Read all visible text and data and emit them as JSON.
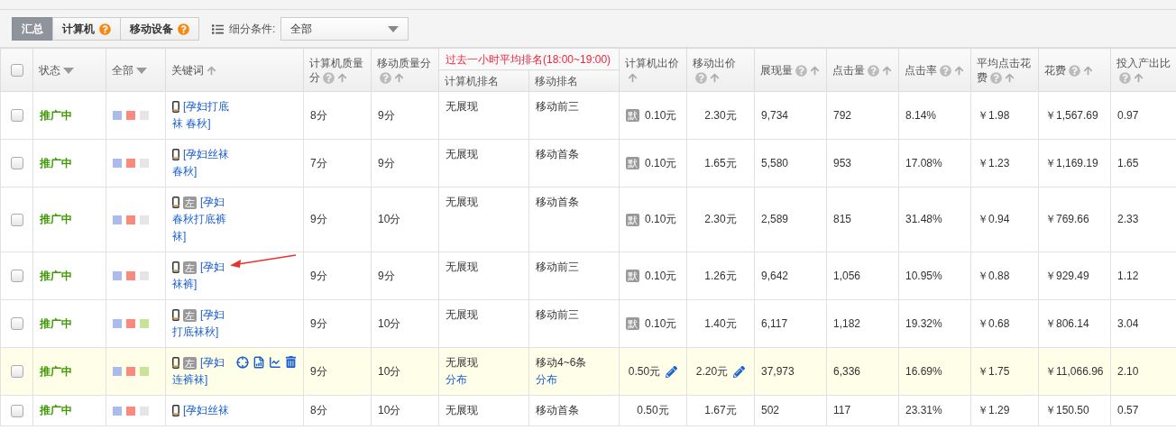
{
  "toolbar": {
    "tabs": [
      {
        "label": "汇总",
        "selected": true,
        "help": false
      },
      {
        "label": "计算机",
        "selected": false,
        "help": true
      },
      {
        "label": "移动设备",
        "selected": false,
        "help": true
      }
    ],
    "filter_label": "细分条件:",
    "filter_value": "全部"
  },
  "header": {
    "checked": false,
    "columns": [
      {
        "kind": "column",
        "label_lines": [
          "状态"
        ],
        "dropdown": true
      },
      {
        "kind": "column",
        "label_lines": [
          "全部"
        ],
        "dropdown": true
      },
      {
        "kind": "column",
        "label_lines": [
          "关键词"
        ],
        "sort": true
      },
      {
        "kind": "column",
        "label_lines": [
          "计算机质量",
          "分"
        ],
        "help": true,
        "sort": true
      },
      {
        "kind": "column",
        "label_lines": [
          "移动质量分"
        ],
        "help": true,
        "sort": true
      },
      {
        "kind": "group",
        "label": "过去一小时平均排名(18:00~19:00)",
        "children": [
          {
            "label": "计算机排名"
          },
          {
            "label": "移动排名"
          }
        ]
      },
      {
        "kind": "column",
        "label_lines": [
          "计算机出价"
        ],
        "sort": true
      },
      {
        "kind": "column",
        "label_lines": [
          "移动出价"
        ],
        "help": true,
        "sort": true
      },
      {
        "kind": "column",
        "label_lines": [
          "展现量"
        ],
        "help": true,
        "sort": true
      },
      {
        "kind": "column",
        "label_lines": [
          "点击量"
        ],
        "help": true,
        "sort": true
      },
      {
        "kind": "column",
        "label_lines": [
          "点击率"
        ],
        "help": true,
        "sort": true
      },
      {
        "kind": "column",
        "label_lines": [
          "平均点击花",
          "费"
        ],
        "help": true,
        "sort": true
      },
      {
        "kind": "column",
        "label_lines": [
          "花费"
        ],
        "help": true,
        "sort": true
      },
      {
        "kind": "column",
        "label_lines": [
          "投入产出比"
        ],
        "help": true,
        "sort": true
      }
    ]
  },
  "rows": [
    {
      "checked": false,
      "selected": false,
      "status": "推广中",
      "flags": [
        {
          "color": "#a9bbef"
        },
        {
          "color": "#fa8a7d"
        },
        {
          "color": "#e5e5e5"
        }
      ],
      "keyword_lines": [
        "[孕妇打底",
        "袜 春秋]"
      ],
      "annotated": false,
      "pc_quality": "8分",
      "mobile_quality": "9分",
      "pc_rank": "无展现",
      "mobile_rank": "移动前三",
      "default_badge": "默",
      "pc_bid": "0.10元",
      "mobile_bid": "2.30元",
      "impressions": "9,734",
      "clicks": "792",
      "ctr": "8.14%",
      "cpc": "￥1.98",
      "cost": "￥1,567.69",
      "roi": "0.97"
    },
    {
      "checked": false,
      "selected": false,
      "status": "推广中",
      "flags": [
        {
          "color": "#a9bbef"
        },
        {
          "color": "#fa8a7d"
        },
        {
          "color": "#e5e5e5"
        }
      ],
      "keyword_lines": [
        "[孕妇丝袜",
        "春秋]"
      ],
      "annotated": false,
      "pc_quality": "7分",
      "mobile_quality": "9分",
      "pc_rank": "无展现",
      "mobile_rank": "移动首条",
      "default_badge": "默",
      "pc_bid": "0.10元",
      "mobile_bid": "1.65元",
      "impressions": "5,580",
      "clicks": "953",
      "ctr": "17.08%",
      "cpc": "￥1.23",
      "cost": "￥1,169.19",
      "roi": "1.65"
    },
    {
      "checked": false,
      "selected": false,
      "status": "推广中",
      "flags": [
        {
          "color": "#a9bbef"
        },
        {
          "color": "#fa8a7d"
        },
        {
          "color": "#e5e5e5"
        }
      ],
      "side_badge": "左",
      "keyword_lines": [
        "[孕妇",
        "春秋打底裤",
        "袜]"
      ],
      "annotated": false,
      "pc_quality": "9分",
      "mobile_quality": "10分",
      "pc_rank": "无展现",
      "mobile_rank": "移动首条",
      "default_badge": "默",
      "pc_bid": "0.10元",
      "mobile_bid": "2.30元",
      "impressions": "2,589",
      "clicks": "815",
      "ctr": "31.48%",
      "cpc": "￥0.94",
      "cost": "￥769.66",
      "roi": "2.33"
    },
    {
      "checked": false,
      "selected": false,
      "status": "推广中",
      "flags": [
        {
          "color": "#a9bbef"
        },
        {
          "color": "#fa8a7d"
        },
        {
          "color": "#e5e5e5"
        }
      ],
      "side_badge": "左",
      "keyword_lines": [
        "[孕妇",
        "袜裤]"
      ],
      "annotated": true,
      "pc_quality": "9分",
      "mobile_quality": "9分",
      "pc_rank": "无展现",
      "mobile_rank": "移动前三",
      "default_badge": "默",
      "pc_bid": "0.10元",
      "mobile_bid": "1.26元",
      "impressions": "9,642",
      "clicks": "1,056",
      "ctr": "10.95%",
      "cpc": "￥0.88",
      "cost": "￥929.49",
      "roi": "1.12"
    },
    {
      "checked": false,
      "selected": false,
      "status": "推广中",
      "flags": [
        {
          "color": "#a9bbef"
        },
        {
          "color": "#fa8a7d"
        },
        {
          "color": "#c9e396"
        }
      ],
      "side_badge": "左",
      "keyword_lines": [
        "[孕妇",
        "打底袜秋]"
      ],
      "annotated": false,
      "pc_quality": "9分",
      "mobile_quality": "10分",
      "pc_rank": "无展现",
      "mobile_rank": "移动前三",
      "default_badge": "默",
      "pc_bid": "0.10元",
      "mobile_bid": "1.40元",
      "impressions": "6,117",
      "clicks": "1,182",
      "ctr": "19.32%",
      "cpc": "￥0.68",
      "cost": "￥806.14",
      "roi": "3.04"
    },
    {
      "checked": false,
      "selected": true,
      "status": "推广中",
      "flags": [
        {
          "color": "#a9bbef"
        },
        {
          "color": "#fa8a7d"
        },
        {
          "color": "#c9e396"
        }
      ],
      "side_badge": "左",
      "keyword_lines": [
        "[孕妇",
        "连裤袜]"
      ],
      "annotated": false,
      "pc_quality": "9分",
      "mobile_quality": "10分",
      "pc_rank": "无展现",
      "pc_rank_link": "分布",
      "mobile_rank": "移动4~6条",
      "mobile_rank_link": "分布",
      "pc_bid": "0.50元",
      "mobile_bid": "2.20元",
      "impressions": "37,973",
      "clicks": "6,336",
      "ctr": "16.69%",
      "cpc": "￥1.75",
      "cost": "￥11,066.96",
      "roi": "2.10"
    },
    {
      "checked": false,
      "selected": false,
      "status": "推广中",
      "flags": [
        {
          "color": "#a9bbef"
        },
        {
          "color": "#fa8a7d"
        },
        {
          "color": "#e5e5e5"
        }
      ],
      "keyword_lines": [
        "[孕妇丝袜"
      ],
      "annotated": false,
      "pc_quality": "8分",
      "mobile_quality": "10分",
      "pc_rank": "无展现",
      "mobile_rank": "移动首条",
      "pc_bid": "0.50元",
      "mobile_bid": "1.67元",
      "impressions": "502",
      "clicks": "117",
      "ctr": "23.31%",
      "cpc": "￥1.29",
      "cost": "￥150.50",
      "roi": "0.57"
    }
  ]
}
